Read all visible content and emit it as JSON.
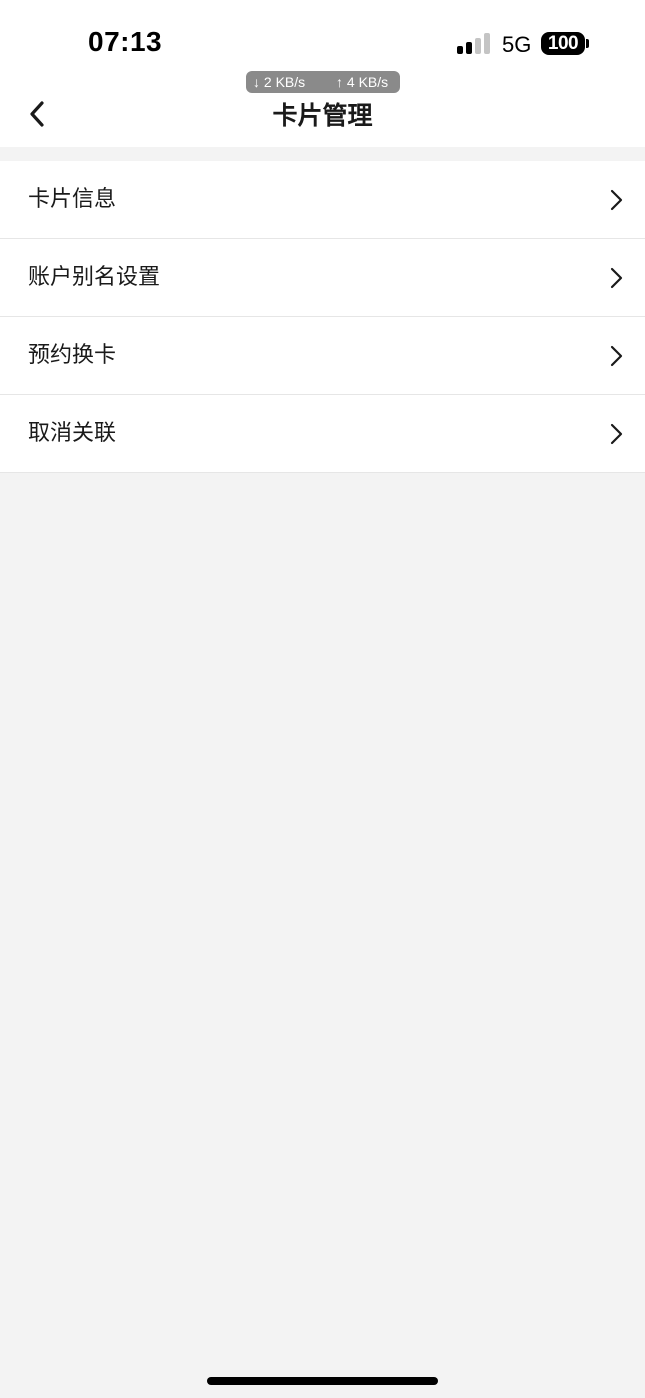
{
  "status_bar": {
    "time": "07:13",
    "network": "5G",
    "battery": "100",
    "download_speed": "↓ 2 KB/s",
    "upload_speed": "↑ 4 KB/s",
    "signal_bars_active": 2,
    "signal_bars_total": 4
  },
  "nav": {
    "title": "卡片管理",
    "back_icon": "chevron-left-icon"
  },
  "menu": {
    "items": [
      {
        "label": "卡片信息",
        "icon": "chevron-right-icon"
      },
      {
        "label": "账户别名设置",
        "icon": "chevron-right-icon"
      },
      {
        "label": "预约换卡",
        "icon": "chevron-right-icon"
      },
      {
        "label": "取消关联",
        "icon": "chevron-right-icon"
      }
    ]
  },
  "colors": {
    "page_background": "#f3f3f3",
    "surface": "#ffffff",
    "text": "#1a1a1a",
    "divider": "#e6e6e6",
    "speed_pill": "#8a8a8a"
  }
}
